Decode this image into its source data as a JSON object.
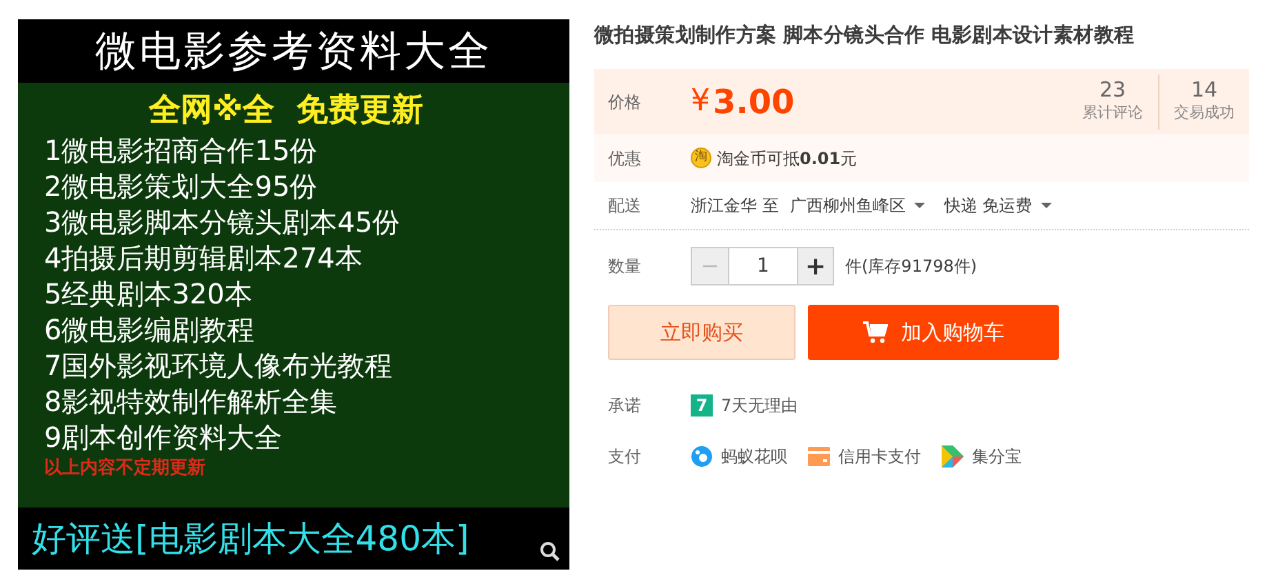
{
  "product_image": {
    "heading": "微电影参考资料大全",
    "slogan": "全网※全  免费更新",
    "items": [
      "1微电影招商合作15份",
      "2微电影策划大全95份",
      "3微电影脚本分镜头剧本45份",
      "4拍摄后期剪辑剧本274本",
      "5经典剧本320本",
      "6微电影编剧教程",
      "7国外影视环境人像布光教程",
      "8影视特效制作解析全集",
      "9剧本创作资料大全"
    ],
    "note": "以上内容不定期更新",
    "footer": "好评送[电影剧本大全480本]"
  },
  "title": "微拍摄策划制作方案 脚本分镜头合作 电影剧本设计素材教程",
  "price": {
    "label": "价格",
    "currency": "¥",
    "amount": "3.00",
    "stats": [
      {
        "value": "23",
        "label": "累计评论"
      },
      {
        "value": "14",
        "label": "交易成功"
      }
    ]
  },
  "promo": {
    "label": "优惠",
    "badge": "淘",
    "text": "淘金币可抵**0.01**元"
  },
  "delivery": {
    "label": "配送",
    "from": "浙江金华 至",
    "to": "广西柳州鱼峰区",
    "method": "快递 免运费"
  },
  "quantity": {
    "label": "数量",
    "minus": "−",
    "value": "1",
    "plus": "+",
    "stock": "件(库存91798件)",
    "minus_disabled": true
  },
  "buttons": [
    {
      "kind": "buy",
      "label": "立即购买"
    },
    {
      "kind": "cart",
      "label": "加入购物车"
    }
  ],
  "promise": {
    "label": "承诺",
    "badge": "7",
    "text": "7天无理由"
  },
  "payment": {
    "label": "支付",
    "methods": [
      {
        "kind": "huabei",
        "label": "蚂蚁花呗"
      },
      {
        "kind": "card",
        "label": "信用卡支付"
      },
      {
        "kind": "jifen",
        "label": "集分宝"
      }
    ]
  }
}
